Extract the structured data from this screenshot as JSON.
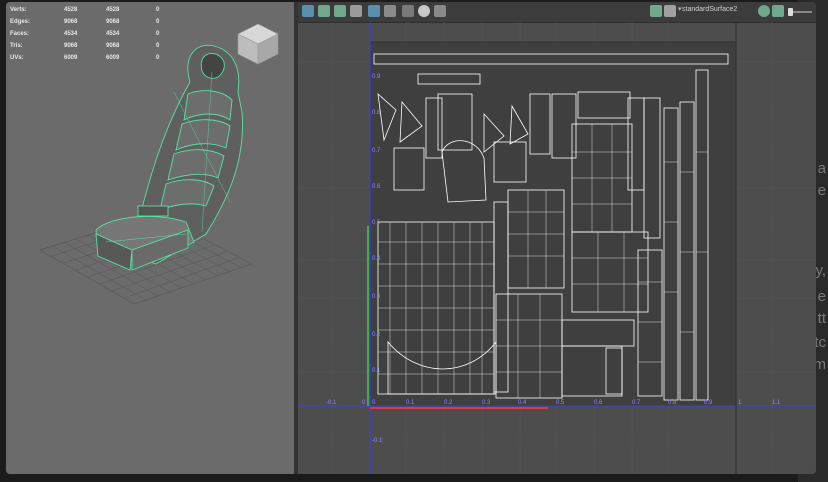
{
  "hud": {
    "rows": [
      {
        "label": "Verts:",
        "v1": "4528",
        "v2": "4528",
        "v3": "0"
      },
      {
        "label": "Edges:",
        "v1": "9068",
        "v2": "9068",
        "v3": "0"
      },
      {
        "label": "Faces:",
        "v1": "4534",
        "v2": "4534",
        "v3": "0"
      },
      {
        "label": "Tris:",
        "v1": "9068",
        "v2": "9068",
        "v3": "0"
      },
      {
        "label": "UVs:",
        "v1": "6009",
        "v2": "6009",
        "v3": "0"
      }
    ]
  },
  "uv_editor": {
    "material_name": "standardSurface2",
    "axis_ticks_x": [
      "-0.1",
      "0",
      "0.1",
      "0.2",
      "0.3",
      "0.4",
      "0.5",
      "0.6",
      "0.7",
      "0.8",
      "0.9",
      "1",
      "1.1"
    ],
    "axis_ticks_y": [
      "0.9",
      "0.8",
      "0.7",
      "0.6",
      "0.5",
      "0.4",
      "0.3",
      "0.2",
      "0.1",
      "0",
      "-0.1"
    ]
  },
  "colors": {
    "accent_green": "#4ec98a",
    "uv_axis_blue": "#3a3aff",
    "uv_axis_red": "#d04040"
  }
}
